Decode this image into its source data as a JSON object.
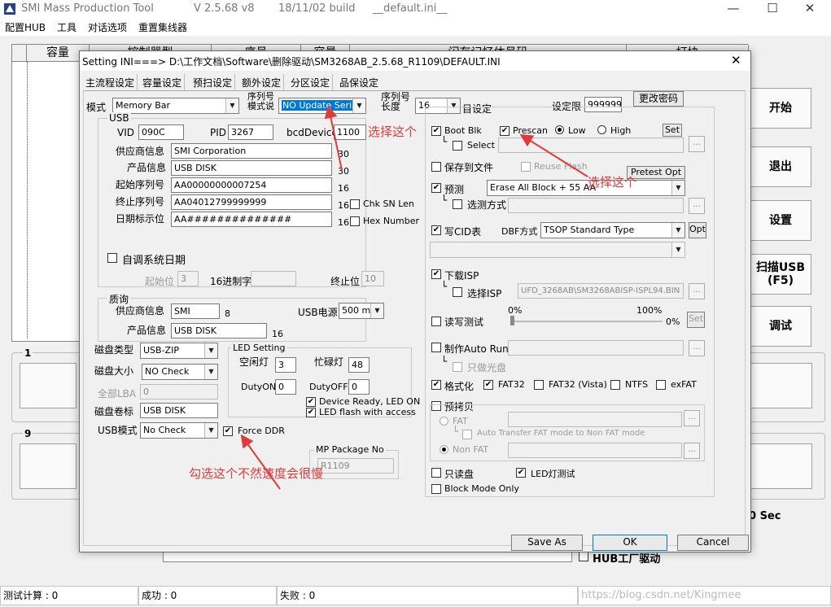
{
  "window": {
    "title": "SMI Mass Production Tool",
    "version": "V 2.5.68   v8",
    "build": "18/11/02 build",
    "ini": "__default.ini__",
    "controls": {
      "minimize": "—",
      "maximize": "☐",
      "close": "✕"
    }
  },
  "menu": [
    "配置HUB",
    "工具",
    "对话选项",
    "重置集线器"
  ],
  "table_headers": [
    "容量",
    "控制器型",
    "序号",
    "容量",
    "闪存记忆体号码",
    "打块"
  ],
  "right_buttons": {
    "start": "开始",
    "exit": "退出",
    "settings": "设置",
    "scan": "扫描USB\n(F5)",
    "debug": "调试"
  },
  "groups": {
    "g1": "1",
    "g9": "9"
  },
  "bg_labels": {
    "sec": "0 Sec",
    "hub": "HUB工厂驱动"
  },
  "status": {
    "count": "测试计算 : 0",
    "success": "成功 : 0",
    "fail": "失败 : 0",
    "watermark": "https://blog.csdn.net/Kingmee"
  },
  "dialog": {
    "title": "Setting  INI===> D:\\工作文档\\Software\\删除驱动\\SM3268AB_2.5.68_R1109\\DEFAULT.INI",
    "close": "✕",
    "tabs": [
      "主流程设定",
      "容量设定",
      "预扫设定",
      "额外设定",
      "分区设定",
      "品保设定"
    ],
    "mode_label": "模式",
    "mode_value": "Memory Bar",
    "serial_mode_label": "序列号\n模式说",
    "serial_mode_value": "NO Update Serial",
    "serial_len_label": "序列号\n长度",
    "serial_len_value": "16",
    "custom_label": "目设定",
    "limit_label": "设定限",
    "limit_value": "999999",
    "change_pw": "更改密码",
    "usb": {
      "title": "USB",
      "vid_label": "VID",
      "vid": "090C",
      "pid_label": "PID",
      "pid": "3267",
      "bcd_label": "bcdDevice",
      "bcd": "1100",
      "vendor_label": "供应商信息",
      "vendor": "SMI Corporation",
      "vendor_len": "30",
      "product_label": "产品信息",
      "product": "USB DISK",
      "product_len": "30",
      "start_sn_label": "起始序列号",
      "start_sn": "AA00000000007254",
      "start_sn_len": "16",
      "end_sn_label": "终止序列号",
      "end_sn": "AA04012799999999",
      "end_sn_len": "16",
      "date_label": "日期标示位",
      "date": "AA##############",
      "date_len": "16",
      "chk_sn_len": "Chk SN Len",
      "hex_number": "Hex Number",
      "auto_date": "自调系统日期",
      "start_bit_label": "起始位",
      "start_bit": "3",
      "hex_label": "16进制字",
      "end_bit_label": "终止位",
      "end_bit": "10"
    },
    "quality": {
      "title": "质询",
      "vendor_label": "供应商信息",
      "vendor": "SMI",
      "vendor_len": "8",
      "power_label": "USB电源",
      "power": "500 mA",
      "product_label": "产品信息",
      "product": "USB DISK",
      "product_len": "16"
    },
    "disk_type_label": "磁盘类型",
    "disk_type": "USB-ZIP",
    "disk_size_label": "磁盘大小",
    "disk_size": "NO Check",
    "lba_label": "全部LBA",
    "lba": "0",
    "volume_label": "磁盘卷标",
    "volume": "USB DISK",
    "usb_mode_label": "USB模式",
    "usb_mode": "No Check",
    "force_ddr": "Force DDR",
    "led": {
      "title": "LED Setting",
      "idle_label": "空闲灯",
      "idle": "3",
      "busy_label": "忙碌灯",
      "busy": "48",
      "dutyon_label": "DutyON",
      "dutyon": "0",
      "dutyoff_label": "DutyOFF",
      "dutyoff": "0",
      "ready": "Device Ready, LED ON",
      "flash": "LED flash with access"
    },
    "mp_package_label": "MP Package No",
    "mp_package": "R1109",
    "right": {
      "boot_blk": "Boot Blk",
      "prescan": "Prescan",
      "low": "Low",
      "high": "High",
      "set": "Set",
      "select": "Select",
      "save_file": "保存到文件",
      "reuse_flash": "Reuse Flash",
      "pretest_opt": "Pretest Opt",
      "pretest": "预测",
      "erase": "Erase All Block + 55 AA",
      "pretest_method": "选测方式",
      "write_cid": "写CID表",
      "dbf_label": "DBF方式",
      "dbf": "TSOP Standard Type",
      "opt": "Opt",
      "download_isp": "下载ISP",
      "select_isp": "选择ISP",
      "isp_path": "UFD_3268AB\\SM3268ABISP-ISPL94.BIN",
      "rw_test": "读写测试",
      "pct0": "0%",
      "pct100": "100%",
      "pct_val": "0%",
      "set2": "Set",
      "autorun": "制作Auto Run",
      "cd_only": "只做光盘",
      "format": "格式化",
      "fat32": "FAT32",
      "fat32v": "FAT32 (Vista)",
      "ntfs": "NTFS",
      "exfat": "exFAT",
      "precopy": "预拷贝",
      "fat": "FAT",
      "auto_transfer": "Auto Transfer FAT mode to Non FAT mode",
      "non_fat": "Non FAT",
      "readonly": "只读盘",
      "led_test": "LED灯测试",
      "block_mode": "Block Mode Only"
    },
    "buttons": {
      "save_as": "Save  As",
      "ok": "OK",
      "cancel": "Cancel"
    },
    "annotations": {
      "a1": "选择这个",
      "a2": "选择这个",
      "a3": "勾选这个不然速度会很慢"
    },
    "accent": "#e03b3b"
  }
}
